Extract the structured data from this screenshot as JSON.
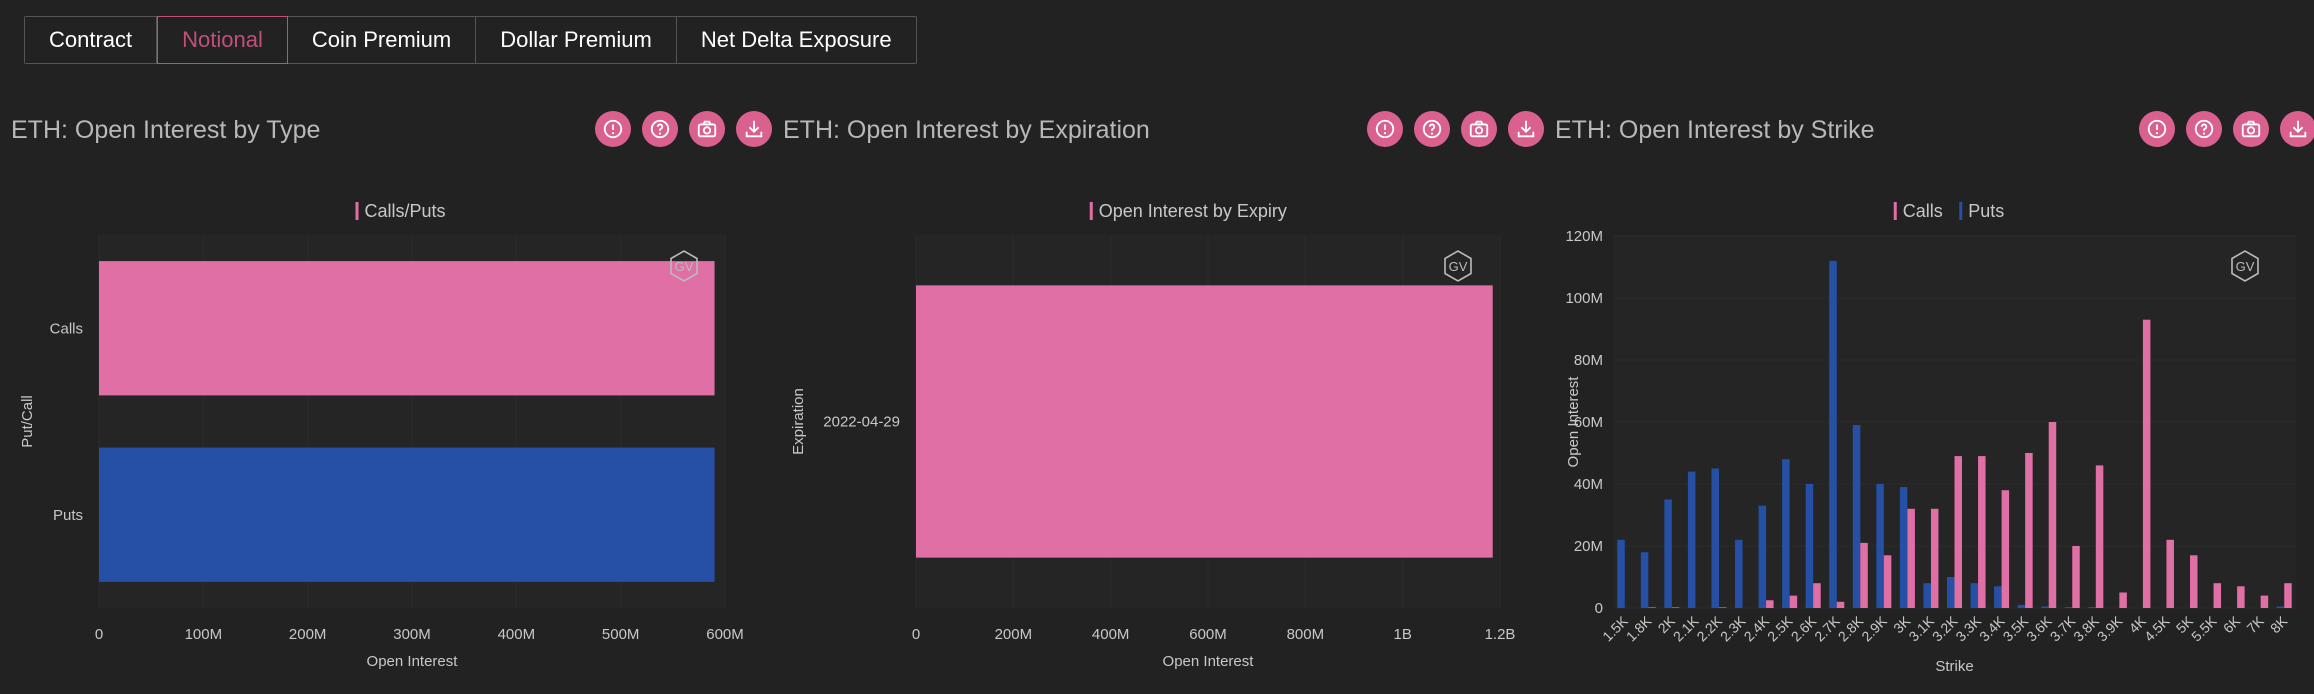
{
  "tabs": [
    {
      "label": "Contract",
      "active": false
    },
    {
      "label": "Notional",
      "active": true
    },
    {
      "label": "Coin Premium",
      "active": false
    },
    {
      "label": "Dollar Premium",
      "active": false
    },
    {
      "label": "Net Delta Exposure",
      "active": false
    }
  ],
  "colors": {
    "calls": "#e06fa6",
    "puts": "#2550a5",
    "accent": "#d9608f"
  },
  "panels": [
    {
      "title": "ETH: Open Interest by Type",
      "icons": [
        "info-icon",
        "help-icon",
        "camera-icon",
        "download-icon"
      ]
    },
    {
      "title": "ETH: Open Interest by Expiration",
      "icons": [
        "info-icon",
        "help-icon",
        "camera-icon",
        "download-icon"
      ]
    },
    {
      "title": "ETH: Open Interest by Strike",
      "icons": [
        "info-icon",
        "help-icon",
        "camera-icon",
        "download-icon"
      ]
    }
  ],
  "watermark": "GV",
  "chart_data": [
    {
      "type": "bar",
      "orientation": "horizontal",
      "legend": [
        "Calls/Puts"
      ],
      "categories": [
        "Calls",
        "Puts"
      ],
      "values": [
        590000000,
        590000000
      ],
      "xlabel": "Open Interest",
      "ylabel": "Put/Call",
      "xlim": [
        0,
        600000000
      ],
      "xticks": [
        "0",
        "100M",
        "200M",
        "300M",
        "400M",
        "500M",
        "600M"
      ]
    },
    {
      "type": "bar",
      "orientation": "horizontal",
      "legend": [
        "Open Interest by Expiry"
      ],
      "categories": [
        "2022-04-29"
      ],
      "values": [
        1185000000
      ],
      "xlabel": "Open Interest",
      "ylabel": "Expiration",
      "xlim": [
        0,
        1200000000
      ],
      "xticks": [
        "0",
        "200M",
        "400M",
        "600M",
        "800M",
        "1B",
        "1.2B"
      ]
    },
    {
      "type": "bar",
      "legend": [
        "Calls",
        "Puts"
      ],
      "categories": [
        "1.5K",
        "1.8K",
        "2K",
        "2.1K",
        "2.2K",
        "2.3K",
        "2.4K",
        "2.5K",
        "2.6K",
        "2.7K",
        "2.8K",
        "2.9K",
        "3K",
        "3.1K",
        "3.2K",
        "3.3K",
        "3.4K",
        "3.5K",
        "3.6K",
        "3.7K",
        "3.8K",
        "3.9K",
        "4K",
        "4.5K",
        "5K",
        "5.5K",
        "6K",
        "7K",
        "8K"
      ],
      "series": [
        {
          "name": "Calls",
          "values": [
            0,
            0.2,
            0.2,
            0,
            0.2,
            0,
            2.5,
            4,
            8,
            2,
            21,
            17,
            32,
            32,
            49,
            49,
            38,
            50,
            60,
            20,
            46,
            5,
            93,
            22,
            17,
            8,
            7,
            4,
            8
          ]
        },
        {
          "name": "Puts",
          "values": [
            22,
            18,
            35,
            44,
            45,
            22,
            33,
            48,
            40,
            112,
            59,
            40,
            39,
            8,
            10,
            8,
            7,
            1,
            0.5,
            0.3,
            0.3,
            0,
            0,
            0,
            0,
            0,
            0,
            0,
            0.5
          ]
        }
      ],
      "xlabel": "Strike",
      "ylabel": "Open Interest",
      "ylim": [
        0,
        120
      ],
      "yticks": [
        "0",
        "20M",
        "40M",
        "60M",
        "80M",
        "100M",
        "120M"
      ]
    }
  ]
}
